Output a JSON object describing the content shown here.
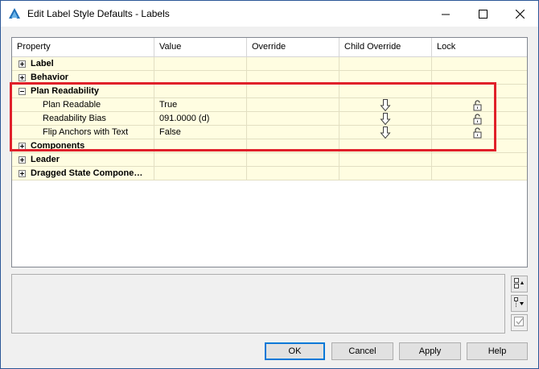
{
  "window": {
    "title": "Edit Label Style Defaults - Labels",
    "icons": [
      "app-icon",
      "minimize-icon",
      "maximize-icon",
      "close-icon"
    ]
  },
  "grid": {
    "columns": [
      "Property",
      "Value",
      "Override",
      "Child Override",
      "Lock"
    ],
    "rows": [
      {
        "type": "group",
        "expander": "plus",
        "name": "Label",
        "value": ""
      },
      {
        "type": "group",
        "expander": "plus",
        "name": "Behavior",
        "value": ""
      },
      {
        "type": "group",
        "expander": "minus",
        "name": "Plan Readability",
        "value": ""
      },
      {
        "type": "child",
        "name": "Plan Readable",
        "value": "True",
        "child_override_icon": "down-arrow-icon",
        "lock_icon": "unlocked-padlock-icon"
      },
      {
        "type": "child",
        "name": "Readability Bias",
        "value": "091.0000 (d)",
        "child_override_icon": "down-arrow-icon",
        "lock_icon": "unlocked-padlock-icon"
      },
      {
        "type": "child",
        "name": "Flip Anchors with Text",
        "value": "False",
        "child_override_icon": "down-arrow-icon",
        "lock_icon": "unlocked-padlock-icon"
      },
      {
        "type": "group",
        "expander": "plus",
        "name": "Components",
        "value": ""
      },
      {
        "type": "group",
        "expander": "plus",
        "name": "Leader",
        "value": ""
      },
      {
        "type": "group",
        "expander": "plus",
        "name": "Dragged State Compone…",
        "value": ""
      }
    ]
  },
  "side_buttons": [
    "categorized-view-icon",
    "filter-list-icon",
    "checklist-icon"
  ],
  "buttons": {
    "ok": "OK",
    "cancel": "Cancel",
    "apply": "Apply",
    "help": "Help"
  },
  "colors": {
    "row_background": "#fffde1",
    "highlight": "#e0202a",
    "default_button_border": "#0078d7"
  }
}
